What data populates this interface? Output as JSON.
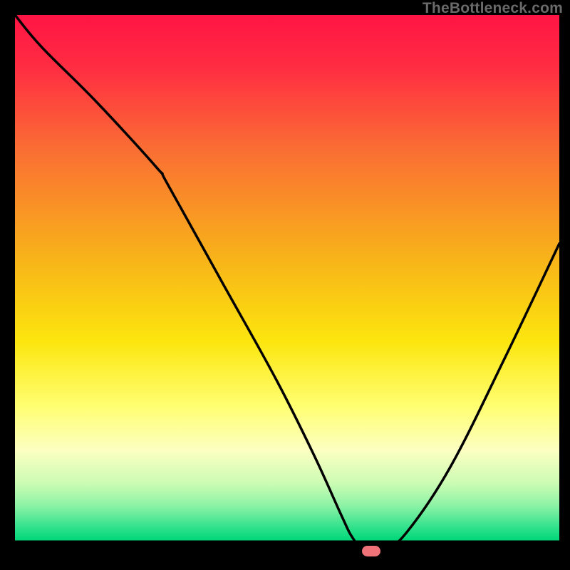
{
  "attribution": "TheBottleneck.com",
  "accent_marker_color": "#ee7277",
  "curve_color": "#000000",
  "gradient_stops": [
    {
      "offset": "0%",
      "color": "#ff1444"
    },
    {
      "offset": "10%",
      "color": "#ff2e42"
    },
    {
      "offset": "25%",
      "color": "#fa6f33"
    },
    {
      "offset": "45%",
      "color": "#f8b419"
    },
    {
      "offset": "60%",
      "color": "#fce60e"
    },
    {
      "offset": "72%",
      "color": "#ffff73"
    },
    {
      "offset": "80%",
      "color": "#fcffc1"
    },
    {
      "offset": "86%",
      "color": "#ccfcb4"
    },
    {
      "offset": "90%",
      "color": "#8ff3a6"
    },
    {
      "offset": "94%",
      "color": "#34e28d"
    },
    {
      "offset": "96.5%",
      "color": "#00d779"
    },
    {
      "offset": "96.5%",
      "color": "#000000"
    },
    {
      "offset": "100%",
      "color": "#000000"
    }
  ],
  "chart_data": {
    "type": "line",
    "title": "",
    "xlabel": "",
    "ylabel": "",
    "xlim": [
      0,
      100
    ],
    "ylim": [
      0,
      100
    ],
    "series": [
      {
        "name": "bottleneck-curve",
        "x": [
          0,
          5,
          15,
          26,
          28,
          38,
          48,
          55,
          60,
          62,
          64,
          68,
          72,
          80,
          90,
          100
        ],
        "values": [
          100,
          94,
          84,
          72,
          69,
          51,
          33,
          19,
          8,
          4,
          2,
          2,
          5,
          17,
          37,
          58
        ]
      }
    ],
    "marker": {
      "x": 65.5,
      "y": 1.5
    },
    "annotations": [
      "TheBottleneck.com"
    ]
  }
}
